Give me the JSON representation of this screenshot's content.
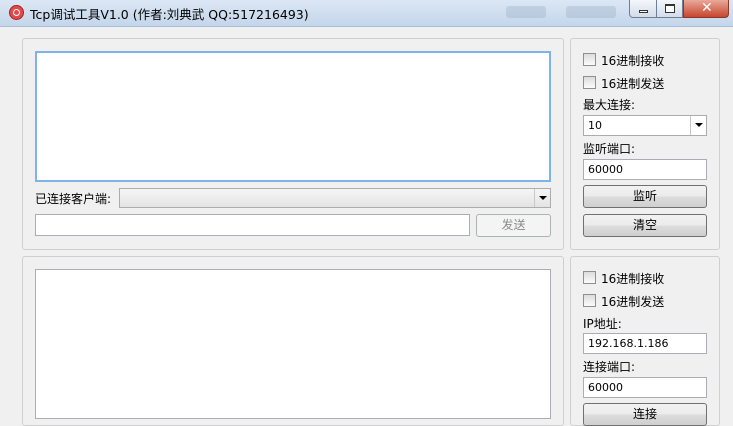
{
  "window": {
    "title": "Tcp调试工具V1.0 (作者:刘典武 QQ:517216493)"
  },
  "server": {
    "client_label": "已连接客户端:",
    "client_value": "",
    "send_value": "",
    "send_button": "发送",
    "hex_receive": "16进制接收",
    "hex_send": "16进制发送",
    "max_conn_label": "最大连接:",
    "max_conn_value": "10",
    "port_label": "监听端口:",
    "port_value": "60000",
    "listen_button": "监听",
    "clear_button": "清空"
  },
  "client": {
    "hex_receive": "16进制接收",
    "hex_send": "16进制发送",
    "ip_label": "IP地址:",
    "ip_value": "192.168.1.186",
    "port_label": "连接端口:",
    "port_value": "60000",
    "connect_button": "连接"
  }
}
